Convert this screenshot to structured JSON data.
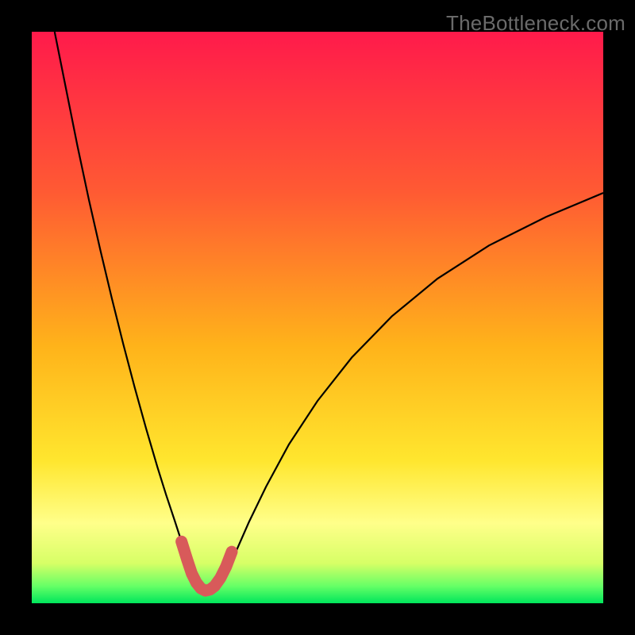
{
  "watermark": "TheBottleneck.com",
  "chart_data": {
    "type": "line",
    "title": "",
    "xlabel": "",
    "ylabel": "",
    "xlim": [
      0,
      100
    ],
    "ylim": [
      0,
      100
    ],
    "grid": false,
    "legend": false,
    "background_gradient": {
      "stops": [
        {
          "offset": 0.0,
          "color": "#ff1a4b"
        },
        {
          "offset": 0.28,
          "color": "#ff5a33"
        },
        {
          "offset": 0.55,
          "color": "#ffb31a"
        },
        {
          "offset": 0.75,
          "color": "#ffe62e"
        },
        {
          "offset": 0.86,
          "color": "#ffff8a"
        },
        {
          "offset": 0.93,
          "color": "#d7ff66"
        },
        {
          "offset": 0.97,
          "color": "#66ff66"
        },
        {
          "offset": 1.0,
          "color": "#00e65c"
        }
      ]
    },
    "series": [
      {
        "name": "curve-black",
        "stroke": "#000000",
        "stroke_width": 2.2,
        "x": [
          4.0,
          6.0,
          8.0,
          10.0,
          12.0,
          14.0,
          16.0,
          18.0,
          20.0,
          22.0,
          23.5,
          25.0,
          26.2,
          27.2,
          28.0,
          29.0,
          30.0,
          31.0,
          32.0,
          33.0,
          34.2,
          35.8,
          38.0,
          41.0,
          45.0,
          50.0,
          56.0,
          63.0,
          71.0,
          80.0,
          90.0,
          100.0
        ],
        "y": [
          100.0,
          90.0,
          80.0,
          70.6,
          61.8,
          53.4,
          45.4,
          37.8,
          30.6,
          23.8,
          19.0,
          14.5,
          10.8,
          7.8,
          5.4,
          3.4,
          2.2,
          2.0,
          2.2,
          3.4,
          5.8,
          9.2,
          14.2,
          20.4,
          27.8,
          35.4,
          43.0,
          50.2,
          56.8,
          62.6,
          67.6,
          71.8
        ]
      },
      {
        "name": "highlight-red",
        "stroke": "#d85a5a",
        "stroke_width": 15,
        "linecap": "round",
        "x": [
          26.2,
          27.2,
          28.0,
          28.8,
          29.6,
          30.4,
          31.2,
          32.0,
          33.0,
          34.0,
          35.0
        ],
        "y": [
          10.8,
          7.6,
          5.2,
          3.6,
          2.6,
          2.2,
          2.4,
          3.0,
          4.4,
          6.4,
          9.0
        ]
      }
    ]
  }
}
